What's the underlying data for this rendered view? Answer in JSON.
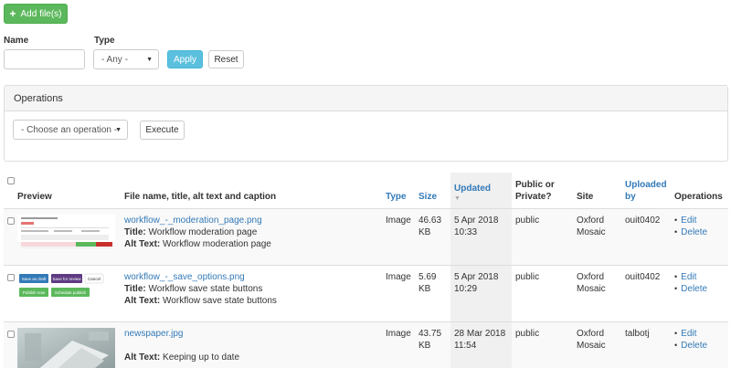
{
  "add_button": {
    "label": "Add file(s)",
    "icon": "plus-icon"
  },
  "filters": {
    "name_label": "Name",
    "name_value": "",
    "type_label": "Type",
    "type_value": "- Any -",
    "apply_label": "Apply",
    "reset_label": "Reset"
  },
  "operations": {
    "heading": "Operations",
    "select_value": "- Choose an operation -",
    "execute_label": "Execute"
  },
  "table": {
    "columns": {
      "preview": "Preview",
      "file": "File name, title, alt text and caption",
      "type": "Type",
      "size": "Size",
      "updated": "Updated",
      "public": "Public or Private?",
      "site": "Site",
      "uploaded_by": "Uploaded by",
      "operations": "Operations"
    },
    "title_label": "Title:",
    "alt_label": "Alt Text:",
    "rows": [
      {
        "file_name": "workflow_-_moderation_page.png",
        "title": "Workflow moderation page",
        "alt_text": "Workflow moderation page",
        "type": "Image",
        "size": "46.63 KB",
        "updated_date": "5 Apr 2018",
        "updated_time": "10:33",
        "visibility": "public",
        "site": "Oxford Mosaic",
        "uploaded_by": "ouit0402",
        "edit": "Edit",
        "delete": "Delete"
      },
      {
        "file_name": "workflow_-_save_options.png",
        "title": "Workflow save state buttons",
        "alt_text": "Workflow save state buttons",
        "type": "Image",
        "size": "5.69 KB",
        "updated_date": "5 Apr 2018",
        "updated_time": "10:29",
        "visibility": "public",
        "site": "Oxford Mosaic",
        "uploaded_by": "ouit0402",
        "edit": "Edit",
        "delete": "Delete",
        "thumb_buttons": [
          "Save as draft",
          "Save for review",
          "Cancel",
          "Publish now",
          "Schedule publish"
        ]
      },
      {
        "file_name": "newspaper.jpg",
        "alt_text": "Keeping up to date",
        "type": "Image",
        "size": "43.75 KB",
        "updated_date": "28 Mar 2018",
        "updated_time": "11:54",
        "visibility": "public",
        "site": "Oxford Mosaic",
        "uploaded_by": "talbotj",
        "edit": "Edit",
        "delete": "Delete"
      }
    ]
  },
  "colors": {
    "success": "#5cb85c",
    "info": "#5bc0de",
    "link": "#337ab7"
  }
}
